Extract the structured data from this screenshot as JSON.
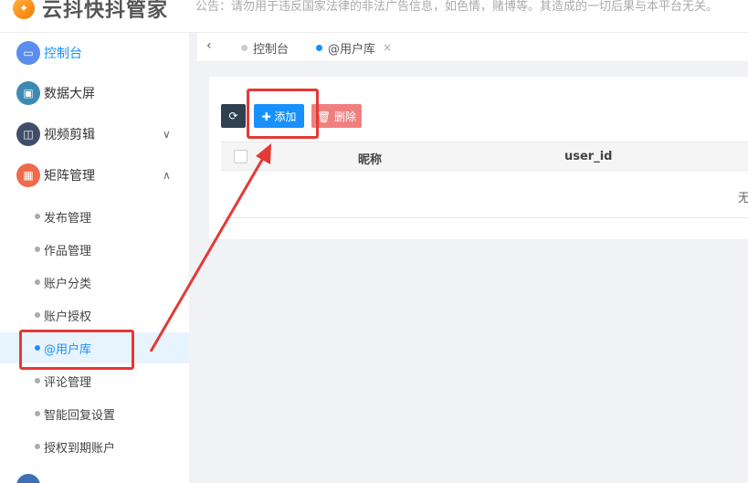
{
  "header": {
    "logo_text": "云抖快抖管家",
    "notice": "公告：请勿用于违反国家法律的非法广告信息，如色情，赌博等。其造成的一切后果与本平台无关。"
  },
  "sidebar": {
    "items": [
      {
        "label": "控制台",
        "icon": "monitor-icon",
        "color": "#5b8def"
      },
      {
        "label": "数据大屏",
        "icon": "screen-icon",
        "color": "#3d8ab5"
      },
      {
        "label": "视频剪辑",
        "icon": "video-edit-icon",
        "color": "#3f4f6b"
      },
      {
        "label": "矩阵管理",
        "icon": "matrix-icon",
        "color": "#ef6a4a"
      }
    ],
    "arrows": {
      "video": "∨",
      "matrix": "∧"
    },
    "sub_items": [
      {
        "label": "发布管理"
      },
      {
        "label": "作品管理"
      },
      {
        "label": "账户分类"
      },
      {
        "label": "账户授权"
      },
      {
        "label": "@用户库"
      },
      {
        "label": "评论管理"
      },
      {
        "label": "智能回复设置"
      },
      {
        "label": "授权到期账户"
      }
    ]
  },
  "tabs": {
    "back": "‹",
    "items": [
      {
        "label": "控制台",
        "dot_color": "#cccccc"
      },
      {
        "label": "@用户库",
        "dot_color": "#1890ff",
        "close": "×"
      }
    ]
  },
  "toolbar": {
    "refresh": "⟳",
    "add_label": "✚ 添加",
    "delete_label": "🗑 删除"
  },
  "table": {
    "columns": [
      "昵称",
      "user_id"
    ],
    "empty_text": "无"
  },
  "colors": {
    "accent": "#1890ff",
    "danger": "#f08080",
    "annotation": "#e53935"
  }
}
